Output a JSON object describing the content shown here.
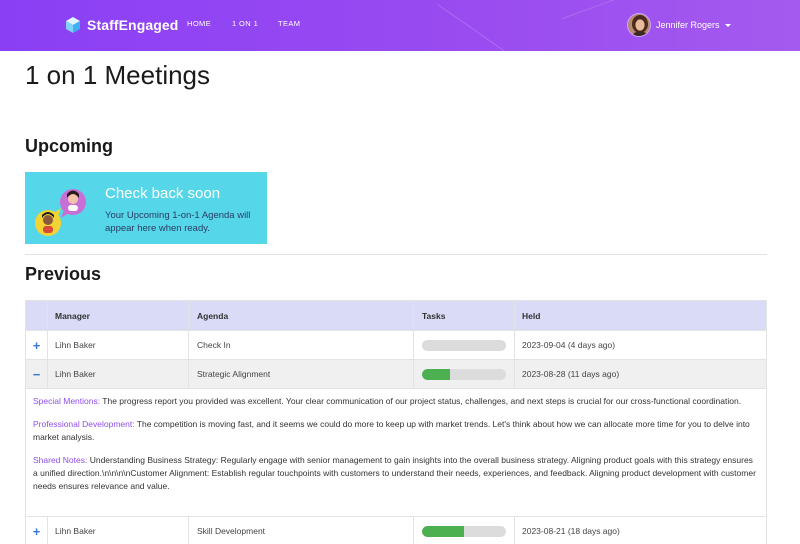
{
  "app": {
    "brand": "StaffEngaged",
    "nav": [
      "HOME",
      "1 ON 1",
      "TEAM"
    ],
    "user_name": "Jennifer Rogers"
  },
  "page": {
    "title": "1 on 1 Meetings",
    "upcoming_title": "Upcoming",
    "previous_title": "Previous"
  },
  "notice": {
    "title": "Check back soon",
    "text": "Your Upcoming 1-on-1 Agenda will appear here when ready."
  },
  "table": {
    "headers": [
      "Manager",
      "Agenda",
      "Tasks",
      "Held"
    ],
    "rows": [
      {
        "toggle": "+",
        "manager": "Lihn Baker",
        "agenda": "Check In",
        "tasks_progress": 0,
        "held": "2023-09-04 (4 days ago)"
      },
      {
        "toggle": "−",
        "manager": "Lihn Baker",
        "agenda": "Strategic Alignment",
        "tasks_progress": 33,
        "held": "2023-08-28 (11 days ago)"
      },
      {
        "toggle": "+",
        "manager": "Lihn Baker",
        "agenda": "Skill Development",
        "tasks_progress": 50,
        "held": "2023-08-21 (18 days ago)"
      }
    ],
    "detail": {
      "special_label": "Special Mentions:",
      "special_text": " The progress report you provided was excellent. Your clear communication of our project status, challenges, and next steps is crucial for our cross-functional coordination.",
      "prof_label": "Professional Development:",
      "prof_text": " The competition is moving fast, and it seems we could do more to keep up with market trends. Let's think about how we can allocate more time for you to delve into market analysis.",
      "shared_label": "Shared Notes:",
      "shared_text": " Understanding Business Strategy: Regularly engage with senior management to gain insights into the overall business strategy. Aligning product goals with this strategy ensures a unified direction.\\n\\n\\n\\nCustomer Alignment: Establish regular touchpoints with customers to understand their needs, experiences, and feedback. Aligning product development with customer needs ensures relevance and value."
    }
  },
  "colors": {
    "navbar": "#8a3ff5",
    "notice_bg": "#56d6e9",
    "table_header": "#d9dbf7",
    "progress_fill": "#4caf50",
    "label_purple": "#8e4ff0",
    "toggle_blue": "#3a78d8"
  }
}
